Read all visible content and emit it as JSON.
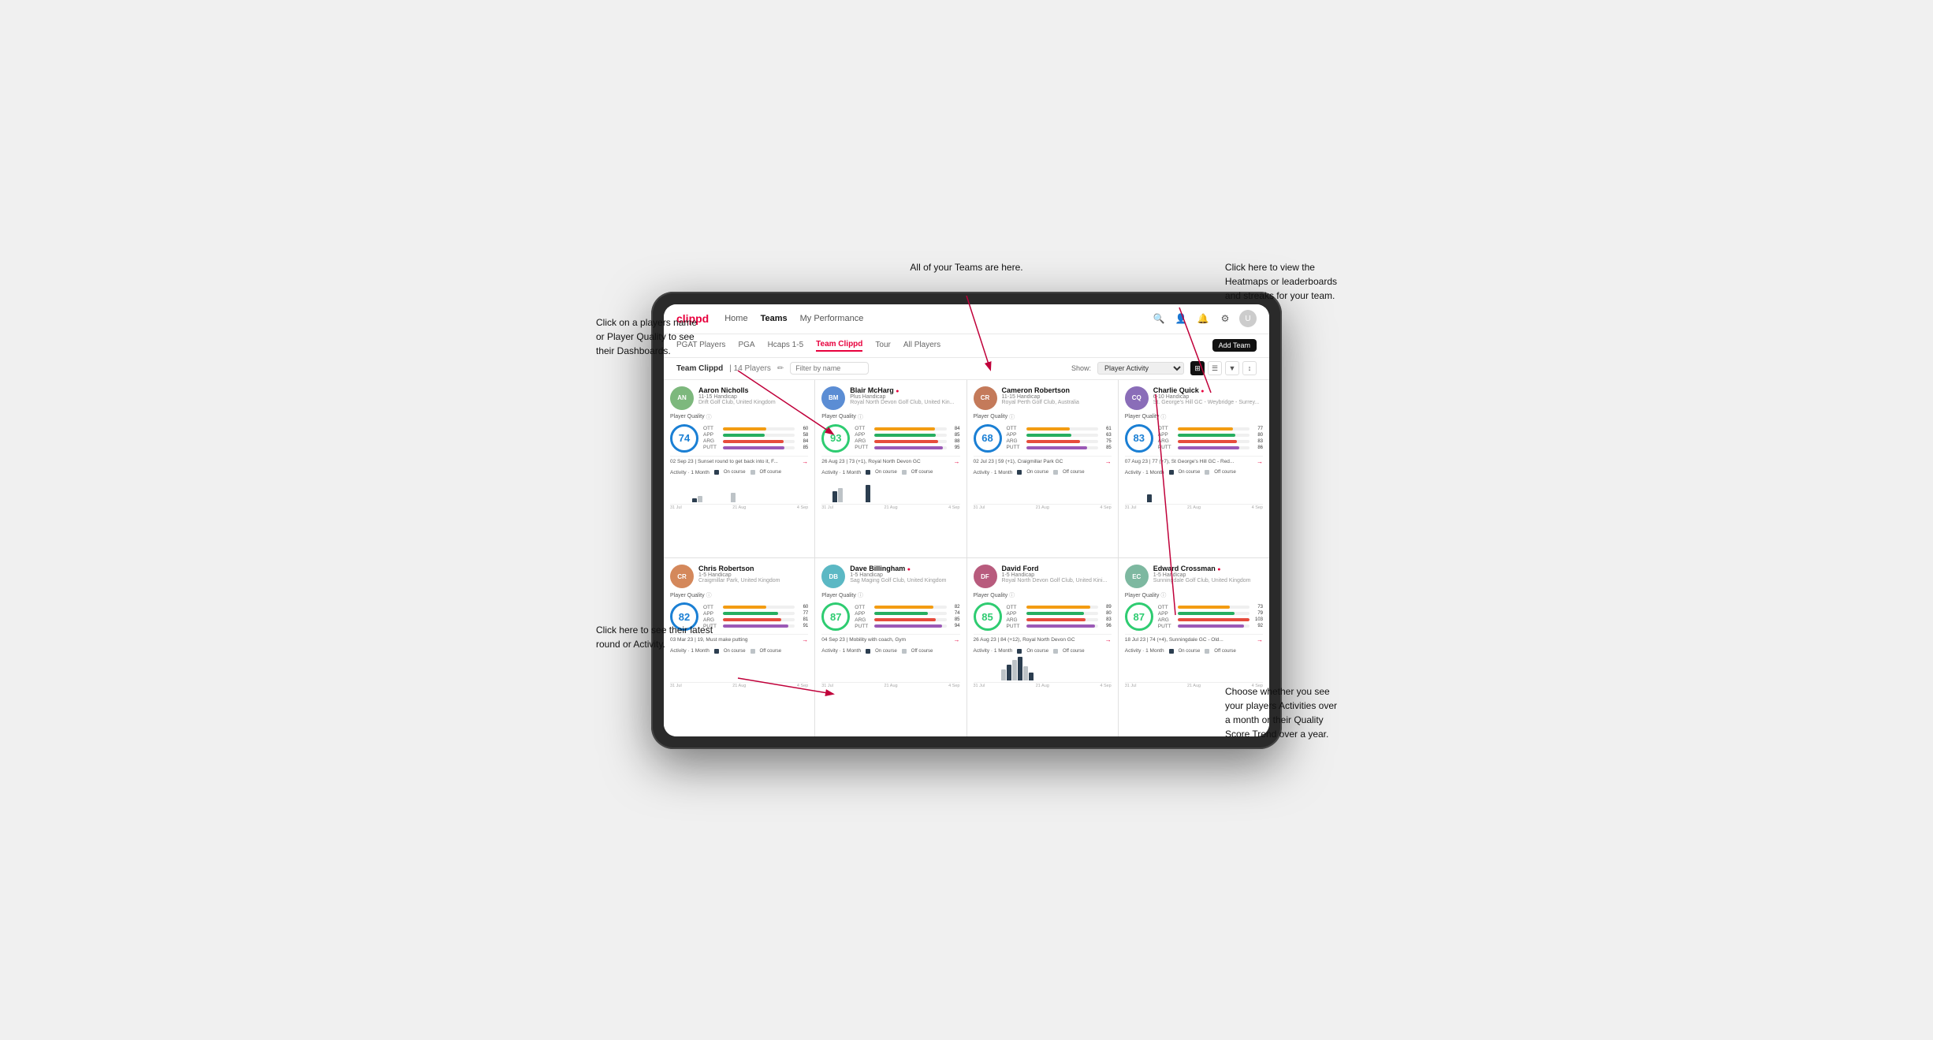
{
  "annotations": {
    "top_center": "All of your Teams are here.",
    "top_right_title": "Click here to view the\nHeatmaps or leaderboards\nand streaks for your team.",
    "left_top_title": "Click on a players name\nor Player Quality to see\ntheir Dashboards.",
    "left_mid_title": "Click here to see their latest\nround or Activity.",
    "bottom_right_title": "Choose whether you see\nyour players Activities over\na month or their Quality\nScore Trend over a year."
  },
  "nav": {
    "logo": "clippd",
    "links": [
      "Home",
      "Teams",
      "My Performance"
    ],
    "active_link": "Teams",
    "icons": [
      "🔍",
      "👤",
      "🔔",
      "⚙",
      "👤"
    ]
  },
  "sub_nav": {
    "links": [
      "PGAT Players",
      "PGA",
      "Hcaps 1-5",
      "Team Clippd",
      "Tour",
      "All Players"
    ],
    "active": "Team Clippd",
    "add_team_btn": "Add Team"
  },
  "toolbar": {
    "team_label": "Team Clippd",
    "team_count": "14 Players",
    "filter_placeholder": "Filter by name",
    "show_label": "Show:",
    "show_option": "Player Activity",
    "view_options": [
      "grid",
      "table",
      "filter",
      "sort"
    ]
  },
  "players": [
    {
      "name": "Aaron Nicholls",
      "handicap": "11-15 Handicap",
      "club": "Drift Golf Club, United Kingdom",
      "score": 74,
      "score_color": "blue",
      "stats": [
        {
          "name": "OTT",
          "val": 60,
          "bar_pct": 60
        },
        {
          "name": "APP",
          "val": 58,
          "bar_pct": 58
        },
        {
          "name": "ARG",
          "val": 84,
          "bar_pct": 84
        },
        {
          "name": "PUTT",
          "val": 85,
          "bar_pct": 85
        }
      ],
      "last_round": "02 Sep 23 | Sunset round to get back into it, F...",
      "activity_bars": [
        0,
        0,
        0,
        0,
        5,
        8,
        0,
        0,
        0,
        0,
        0,
        12,
        0,
        0,
        0
      ]
    },
    {
      "name": "Blair McHarg",
      "handicap": "Plus Handicap",
      "club": "Royal North Devon Golf Club, United Kin...",
      "score": 93,
      "score_color": "green",
      "stats": [
        {
          "name": "OTT",
          "val": 84,
          "bar_pct": 84
        },
        {
          "name": "APP",
          "val": 85,
          "bar_pct": 85
        },
        {
          "name": "ARG",
          "val": 88,
          "bar_pct": 88
        },
        {
          "name": "PUTT",
          "val": 95,
          "bar_pct": 95
        }
      ],
      "last_round": "26 Aug 23 | 73 (+1), Royal North Devon GC",
      "activity_bars": [
        0,
        0,
        14,
        18,
        0,
        0,
        0,
        0,
        22,
        0,
        0,
        0,
        0,
        0,
        0
      ]
    },
    {
      "name": "Cameron Robertson",
      "handicap": "11-15 Handicap",
      "club": "Royal Perth Golf Club, Australia",
      "score": 68,
      "score_color": "blue",
      "stats": [
        {
          "name": "OTT",
          "val": 61,
          "bar_pct": 61
        },
        {
          "name": "APP",
          "val": 63,
          "bar_pct": 63
        },
        {
          "name": "ARG",
          "val": 75,
          "bar_pct": 75
        },
        {
          "name": "PUTT",
          "val": 85,
          "bar_pct": 85
        }
      ],
      "last_round": "02 Jul 23 | 59 (+1), Craigmillar Park GC",
      "activity_bars": [
        0,
        0,
        0,
        0,
        0,
        0,
        0,
        0,
        0,
        0,
        0,
        0,
        0,
        0,
        0
      ]
    },
    {
      "name": "Charlie Quick",
      "handicap": "6-10 Handicap",
      "club": "St. George's Hill GC - Weybridge - Surrey...",
      "score": 83,
      "score_color": "blue",
      "stats": [
        {
          "name": "OTT",
          "val": 77,
          "bar_pct": 77
        },
        {
          "name": "APP",
          "val": 80,
          "bar_pct": 80
        },
        {
          "name": "ARG",
          "val": 83,
          "bar_pct": 83
        },
        {
          "name": "PUTT",
          "val": 86,
          "bar_pct": 86
        }
      ],
      "last_round": "07 Aug 23 | 77 (+7), St George's Hill GC - Red...",
      "activity_bars": [
        0,
        0,
        0,
        0,
        10,
        0,
        0,
        0,
        0,
        0,
        0,
        0,
        0,
        0,
        0
      ]
    },
    {
      "name": "Chris Robertson",
      "handicap": "1-5 Handicap",
      "club": "Craigmillar Park, United Kingdom",
      "score": 82,
      "score_color": "blue",
      "stats": [
        {
          "name": "OTT",
          "val": 60,
          "bar_pct": 60
        },
        {
          "name": "APP",
          "val": 77,
          "bar_pct": 77
        },
        {
          "name": "ARG",
          "val": 81,
          "bar_pct": 81
        },
        {
          "name": "PUTT",
          "val": 91,
          "bar_pct": 91
        }
      ],
      "last_round": "03 Mar 23 | 19, Must make putting",
      "activity_bars": [
        0,
        0,
        0,
        0,
        0,
        0,
        0,
        0,
        0,
        0,
        0,
        0,
        0,
        0,
        0
      ]
    },
    {
      "name": "Dave Billingham",
      "handicap": "1-5 Handicap",
      "club": "Sag Maging Golf Club, United Kingdom",
      "score": 87,
      "score_color": "green",
      "stats": [
        {
          "name": "OTT",
          "val": 82,
          "bar_pct": 82
        },
        {
          "name": "APP",
          "val": 74,
          "bar_pct": 74
        },
        {
          "name": "ARG",
          "val": 85,
          "bar_pct": 85
        },
        {
          "name": "PUTT",
          "val": 94,
          "bar_pct": 94
        }
      ],
      "last_round": "04 Sep 23 | Mobility with coach, Gym",
      "activity_bars": [
        0,
        0,
        0,
        0,
        0,
        0,
        0,
        0,
        0,
        0,
        0,
        0,
        0,
        0,
        0
      ]
    },
    {
      "name": "David Ford",
      "handicap": "1-5 Handicap",
      "club": "Royal North Devon Golf Club, United Kini...",
      "score": 85,
      "score_color": "blue",
      "stats": [
        {
          "name": "OTT",
          "val": 89,
          "bar_pct": 89
        },
        {
          "name": "APP",
          "val": 80,
          "bar_pct": 80
        },
        {
          "name": "ARG",
          "val": 83,
          "bar_pct": 83
        },
        {
          "name": "PUTT",
          "val": 96,
          "bar_pct": 96
        }
      ],
      "last_round": "26 Aug 23 | 84 (+12), Royal North Devon GC",
      "activity_bars": [
        0,
        0,
        0,
        0,
        0,
        14,
        20,
        26,
        30,
        18,
        10,
        0,
        0,
        0,
        0
      ]
    },
    {
      "name": "Edward Crossman",
      "handicap": "1-5 Handicap",
      "club": "Sunningdale Golf Club, United Kingdom",
      "score": 87,
      "score_color": "blue",
      "stats": [
        {
          "name": "OTT",
          "val": 73,
          "bar_pct": 73
        },
        {
          "name": "APP",
          "val": 79,
          "bar_pct": 79
        },
        {
          "name": "ARG",
          "val": 103,
          "bar_pct": 100
        },
        {
          "name": "PUTT",
          "val": 92,
          "bar_pct": 92
        }
      ],
      "last_round": "18 Jul 23 | 74 (+4), Sunningdale GC - Old...",
      "activity_bars": [
        0,
        0,
        0,
        0,
        0,
        0,
        0,
        0,
        0,
        0,
        0,
        0,
        0,
        0,
        0
      ]
    }
  ],
  "chart_dates": [
    "31 Jul",
    "21 Aug",
    "4 Sep"
  ],
  "legend": {
    "on_course": "On course",
    "off_course": "Off course"
  }
}
